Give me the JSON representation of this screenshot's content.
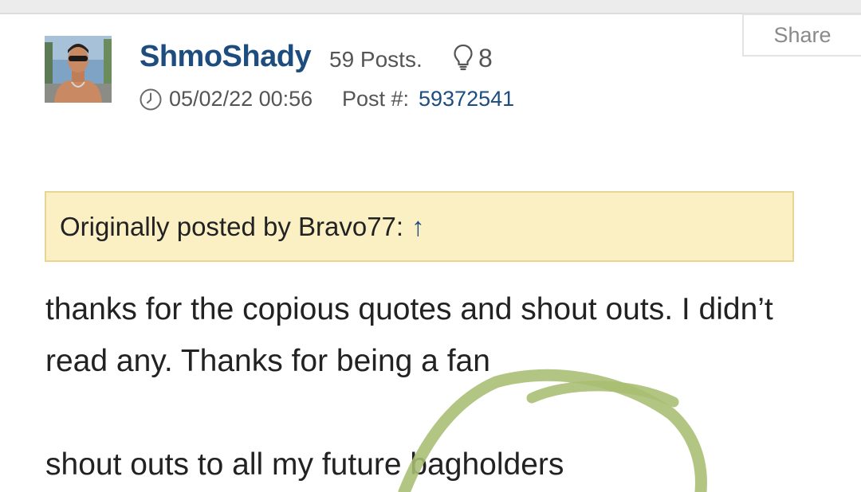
{
  "header": {
    "share_label": "Share"
  },
  "post": {
    "username": "ShmoShady",
    "post_count": "59 Posts.",
    "likes_count": "8",
    "timestamp": "05/02/22 00:56",
    "post_label": "Post #:",
    "post_number": "59372541",
    "quote": {
      "label": "Originally posted by Bravo77:",
      "arrow": "↑"
    },
    "body": [
      "thanks for the copious quotes and shout outs. I didn’t read any. Thanks for being a fan",
      "shout outs to all my future bagholders"
    ]
  },
  "icons": {
    "likes": "lightbulb-icon",
    "time": "clock-icon"
  },
  "colors": {
    "username": "#1d4d7f",
    "link": "#1d4d7f",
    "quote_bg": "#faf0c4",
    "quote_border": "#e8d592",
    "annotation": "#a9bd72"
  }
}
